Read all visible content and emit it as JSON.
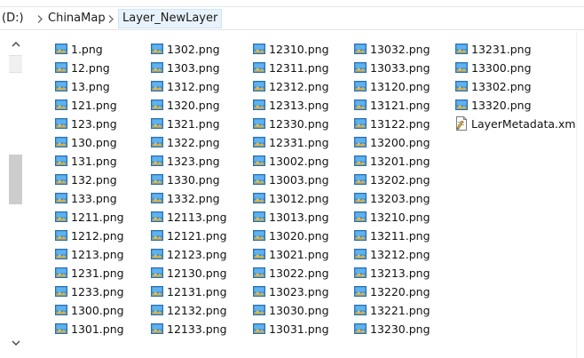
{
  "breadcrumb": {
    "items": [
      "(D:)",
      "ChinaMap",
      "Layer_NewLayer"
    ]
  },
  "files": {
    "columns": [
      [
        "1.png",
        "12.png",
        "13.png",
        "121.png",
        "123.png",
        "130.png",
        "131.png",
        "132.png",
        "133.png",
        "1211.png",
        "1212.png",
        "1213.png",
        "1231.png",
        "1233.png",
        "1300.png",
        "1301.png"
      ],
      [
        "1302.png",
        "1303.png",
        "1312.png",
        "1320.png",
        "1321.png",
        "1322.png",
        "1323.png",
        "1330.png",
        "1332.png",
        "12113.png",
        "12121.png",
        "12123.png",
        "12130.png",
        "12131.png",
        "12132.png",
        "12133.png"
      ],
      [
        "12310.png",
        "12311.png",
        "12312.png",
        "12313.png",
        "12330.png",
        "12331.png",
        "13002.png",
        "13003.png",
        "13012.png",
        "13013.png",
        "13020.png",
        "13021.png",
        "13022.png",
        "13023.png",
        "13030.png",
        "13031.png"
      ],
      [
        "13032.png",
        "13033.png",
        "13120.png",
        "13121.png",
        "13122.png",
        "13200.png",
        "13201.png",
        "13202.png",
        "13203.png",
        "13210.png",
        "13211.png",
        "13212.png",
        "13213.png",
        "13220.png",
        "13221.png",
        "13230.png"
      ],
      [
        "13231.png",
        "13300.png",
        "13302.png",
        "13320.png",
        "LayerMetadata.xml"
      ]
    ]
  },
  "icons": {
    "png": "image-file-icon",
    "xml": "xml-file-icon"
  },
  "colors": {
    "selected_crumb_bg": "#e8f2fb",
    "scroll_thumb": "#cdcdcd"
  }
}
